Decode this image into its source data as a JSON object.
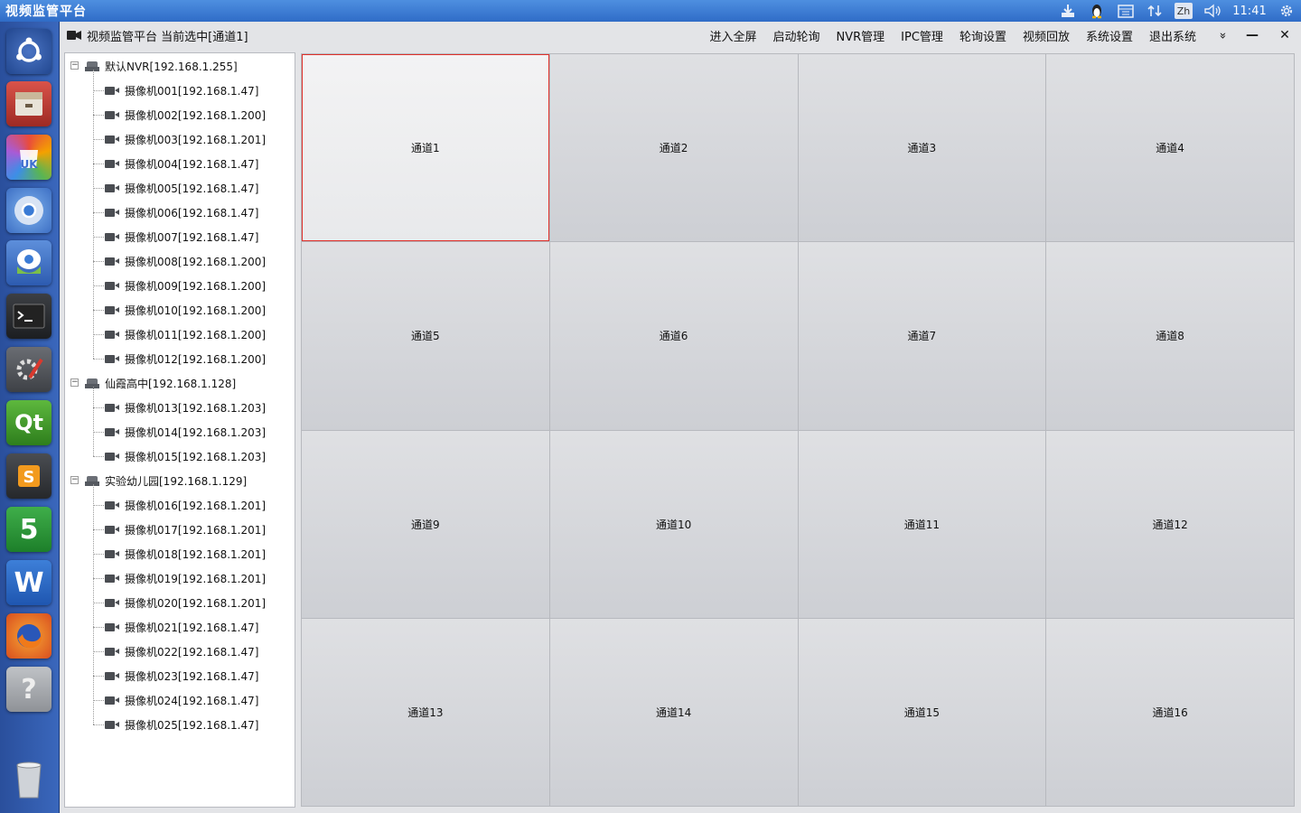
{
  "system_bar": {
    "app_title": "视频监管平台",
    "input_method": "Zh",
    "clock": "11:41"
  },
  "launcher": [
    {
      "name": "ubuntu-dash"
    },
    {
      "name": "file-manager"
    },
    {
      "name": "ubuntu-kylin-software"
    },
    {
      "name": "chromium"
    },
    {
      "name": "youker-assistant"
    },
    {
      "name": "terminal"
    },
    {
      "name": "system-settings"
    },
    {
      "name": "qt-creator"
    },
    {
      "name": "sublime-text"
    },
    {
      "name": "wps-spreadsheets"
    },
    {
      "name": "wps-writer"
    },
    {
      "name": "firefox"
    },
    {
      "name": "help"
    },
    {
      "name": "trash"
    }
  ],
  "window": {
    "title": "视频监管平台  当前选中[通道1]",
    "menu": [
      "进入全屏",
      "启动轮询",
      "NVR管理",
      "IPC管理",
      "轮询设置",
      "视频回放",
      "系统设置",
      "退出系统"
    ],
    "chevron": "»",
    "minimize": "—",
    "close": "✕"
  },
  "tree": [
    {
      "nvr": "默认NVR[192.168.1.255]",
      "expander": "−",
      "cameras": [
        "摄像机001[192.168.1.47]",
        "摄像机002[192.168.1.200]",
        "摄像机003[192.168.1.201]",
        "摄像机004[192.168.1.47]",
        "摄像机005[192.168.1.47]",
        "摄像机006[192.168.1.47]",
        "摄像机007[192.168.1.47]",
        "摄像机008[192.168.1.200]",
        "摄像机009[192.168.1.200]",
        "摄像机010[192.168.1.200]",
        "摄像机011[192.168.1.200]",
        "摄像机012[192.168.1.200]"
      ]
    },
    {
      "nvr": "仙霞高中[192.168.1.128]",
      "expander": "−",
      "cameras": [
        "摄像机013[192.168.1.203]",
        "摄像机014[192.168.1.203]",
        "摄像机015[192.168.1.203]"
      ]
    },
    {
      "nvr": "实验幼儿园[192.168.1.129]",
      "expander": "−",
      "cameras": [
        "摄像机016[192.168.1.201]",
        "摄像机017[192.168.1.201]",
        "摄像机018[192.168.1.201]",
        "摄像机019[192.168.1.201]",
        "摄像机020[192.168.1.201]",
        "摄像机021[192.168.1.47]",
        "摄像机022[192.168.1.47]",
        "摄像机023[192.168.1.47]",
        "摄像机024[192.168.1.47]",
        "摄像机025[192.168.1.47]"
      ]
    }
  ],
  "channels": [
    "通道1",
    "通道2",
    "通道3",
    "通道4",
    "通道5",
    "通道6",
    "通道7",
    "通道8",
    "通道9",
    "通道10",
    "通道11",
    "通道12",
    "通道13",
    "通道14",
    "通道15",
    "通道16"
  ],
  "selected_channel": "通道1",
  "colors": {
    "selection_border": "#e0302a",
    "system_bar": "#3a78d2",
    "launcher": "#2f5aa8"
  }
}
